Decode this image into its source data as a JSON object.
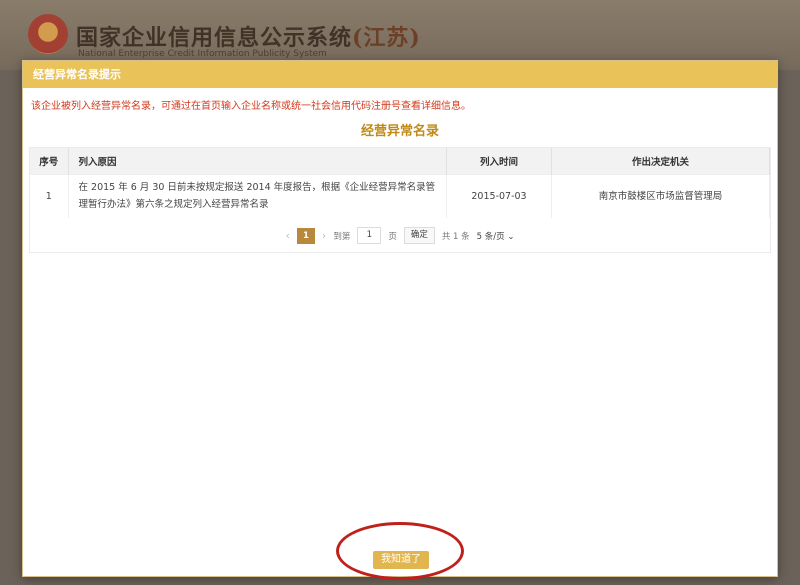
{
  "background": {
    "title_main": "国家企业信用信息公示系统",
    "title_region": "(江苏)",
    "subtitle": "National Enterprise Credit Information Publicity System"
  },
  "modal": {
    "header": "经营异常名录提示",
    "notice": "该企业被列入经营异常名录，可通过在首页输入企业名称或统一社会信用代码注册号查看详细信息。",
    "list_title": "经营异常名录",
    "columns": [
      "序号",
      "列入原因",
      "列入时间",
      "作出决定机关"
    ],
    "rows": [
      {
        "seq": "1",
        "reason": "在 2015 年 6 月 30 日前未按规定报送 2014 年度报告，根据《企业经营异常名录管理暂行办法》第六条之规定列入经营异常名录",
        "date": "2015-07-03",
        "authority": "南京市鼓楼区市场监督管理局"
      }
    ],
    "pager": {
      "prev": "‹",
      "current_page": "1",
      "next": "›",
      "goto_label": "到第",
      "goto_value": "1",
      "page_unit": "页",
      "confirm": "确定",
      "total": "共 1 条",
      "page_size": "5 条/页"
    },
    "ok_button": "我知道了"
  },
  "colors": {
    "header_bg": "#e9c35a",
    "notice_text": "#d23a1e",
    "list_title": "#c08a17",
    "active_page": "#b8893c",
    "highlight": "#c0201a"
  }
}
